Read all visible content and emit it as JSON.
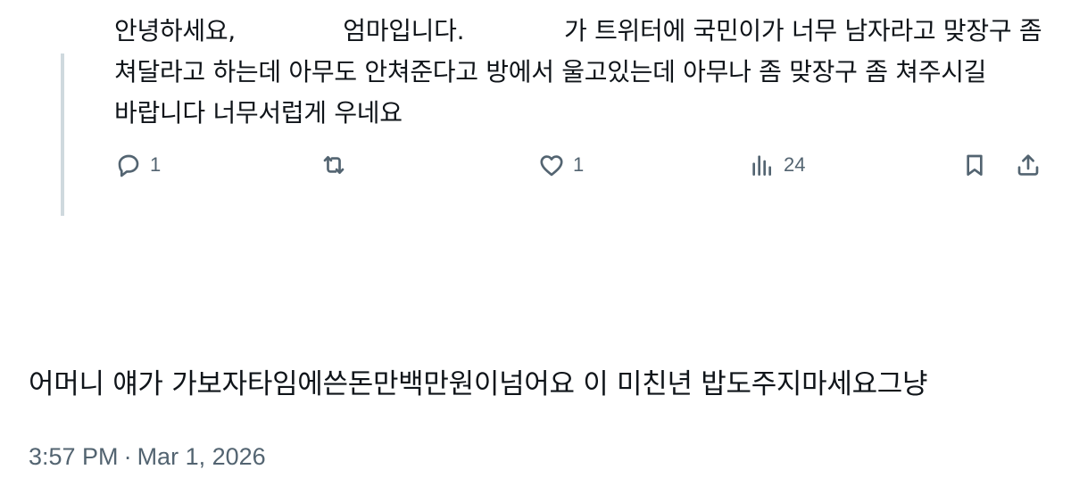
{
  "parent_tweet": {
    "text": "안녕하세요,              엄마입니다.             가 트위터에 국민이가 너무 남자라고 맞장구 좀 쳐달라고 하는데 아무도 안쳐준다고 방에서 울고있는데 아무나 좀 맞장구 좀 쳐주시길 바랍니다 너무서럽게 우네요",
    "reply_count": "1",
    "retweet_count": "",
    "like_count": "1",
    "view_count": "24"
  },
  "main_tweet": {
    "text": "어머니 얘가 가보자타임에쓴돈만백만원이넘어요 이 미친년 밥도주지마세요그냥",
    "time": "3:57 PM",
    "separator": "·",
    "date": "Mar 1, 2026"
  },
  "icons": {
    "reply": "speech-bubble-icon",
    "retweet": "retweet-arrows-icon",
    "like": "heart-icon",
    "views": "bar-chart-icon",
    "bookmark": "bookmark-icon",
    "share": "share-upload-icon"
  },
  "colors": {
    "text": "#0f1419",
    "secondary": "#536471",
    "thread_line": "#cfd9de"
  }
}
